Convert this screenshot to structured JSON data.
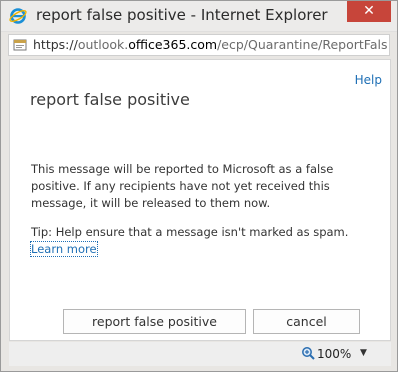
{
  "window": {
    "title": "report false positive - Internet Explorer",
    "close_glyph": "✕"
  },
  "address": {
    "scheme": "https://",
    "domain_pre": "outlook.",
    "domain": "office365.com",
    "path": "/ecp/Quarantine/ReportFalsePosi"
  },
  "page": {
    "help": "Help",
    "title": "report false positive",
    "message": "This message will be reported to Microsoft as a false positive. If any recipients have not yet received this message, it will be released to them now.",
    "tip": "Tip: Help ensure that a message isn't marked as spam.",
    "learn_more": "Learn more"
  },
  "buttons": {
    "report": "report false positive",
    "cancel": "cancel"
  },
  "status": {
    "zoom": "100%"
  },
  "colors": {
    "link": "#1e6fb5",
    "close": "#c7453a"
  }
}
